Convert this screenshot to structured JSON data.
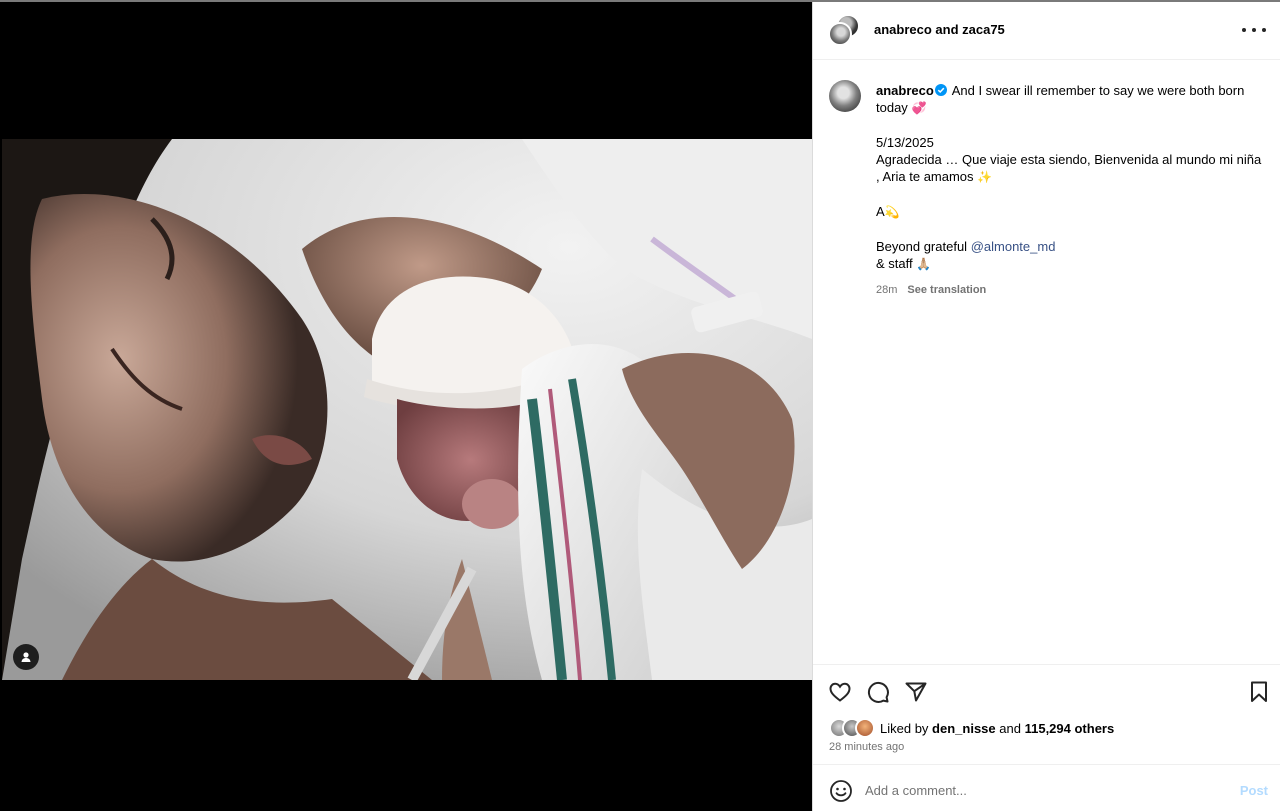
{
  "header": {
    "title": "anabreco and zaca75",
    "more_icon": "more-horizontal-icon"
  },
  "caption": {
    "username": "anabreco",
    "lines": {
      "text_1": "And I swear ill remember to say we were both born today",
      "emoji_1": "💞",
      "date": "5/13/2025",
      "text_2": "Agradecida … Que viaje esta siendo, Bienvenida al mundo mi niña , Aria te amamos",
      "emoji_2": "✨",
      "text_3": "A",
      "emoji_3": "💫",
      "text_4": "Beyond grateful",
      "mention": "@almonte_md",
      "text_5": "& staff",
      "emoji_4": "🙏🏼"
    },
    "time": "28m",
    "see_translation": "See translation"
  },
  "actions": {
    "like_icon": "heart-icon",
    "comment_icon": "comment-icon",
    "share_icon": "send-icon",
    "save_icon": "bookmark-icon"
  },
  "likes": {
    "prefix": "Liked by",
    "user": "den_nisse",
    "middle": "and",
    "count": "115,294 others"
  },
  "time_ago": "28 minutes ago",
  "comment": {
    "placeholder": "Add a comment...",
    "post_label": "Post"
  },
  "colors": {
    "mention": "#385185",
    "verified": "#0095f6",
    "post_disabled": "#b3dbff",
    "muted": "#737373"
  }
}
